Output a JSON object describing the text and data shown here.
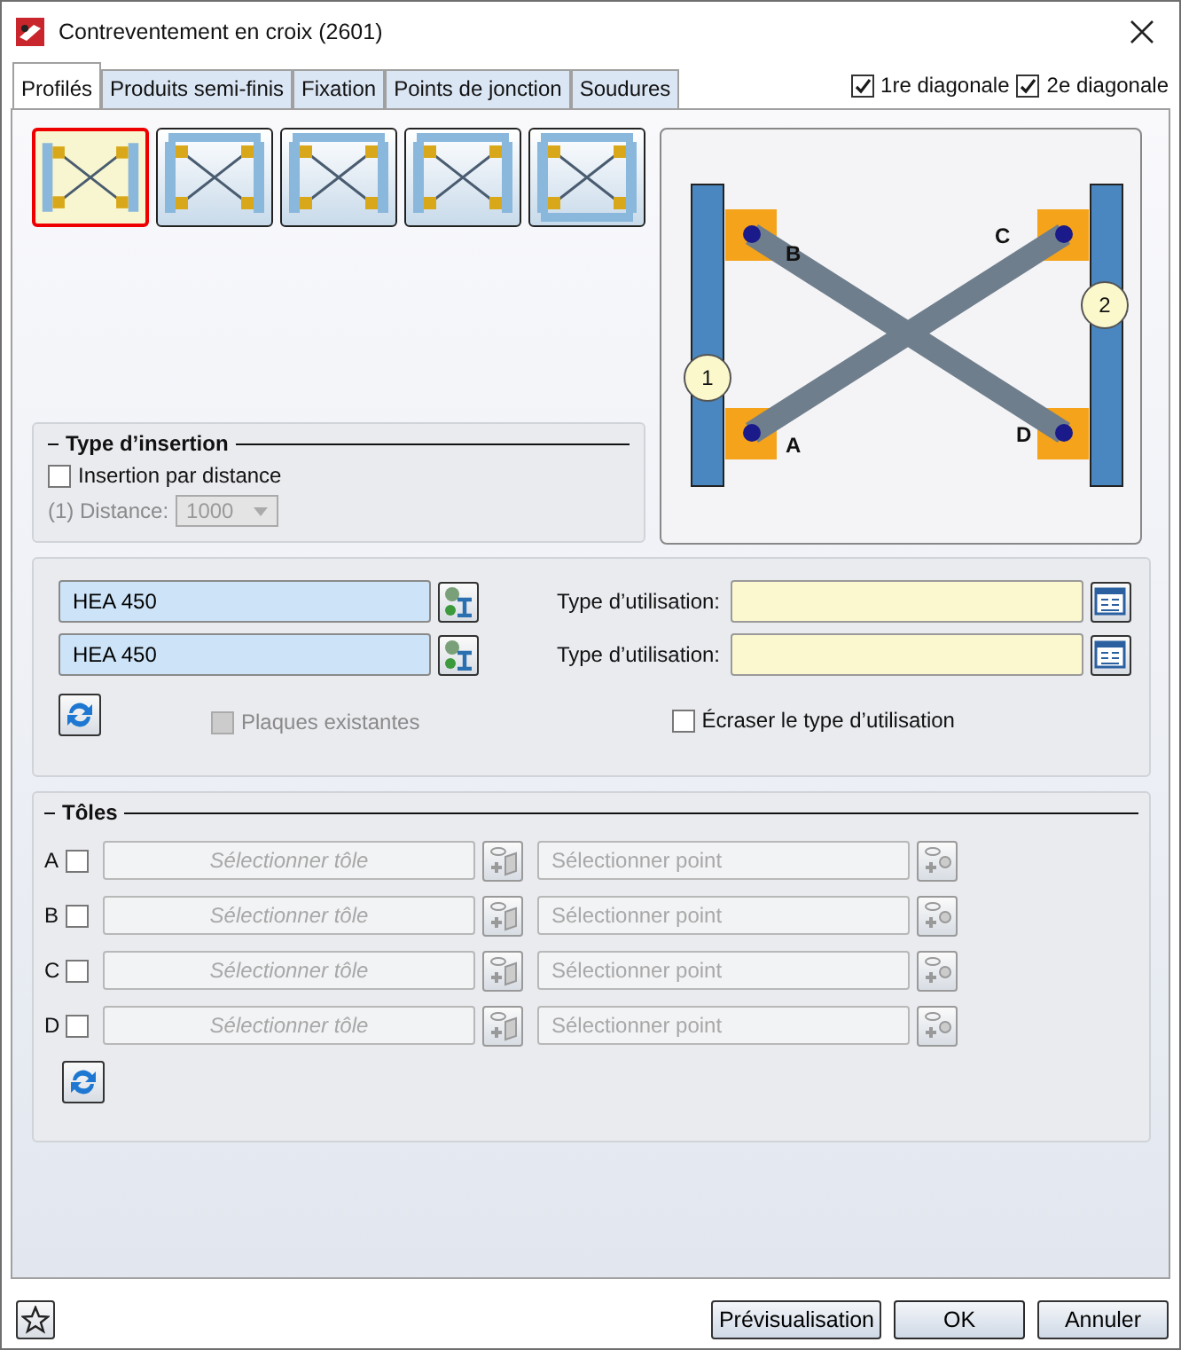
{
  "window": {
    "title": "Contreventement en croix (2601)"
  },
  "tabs": [
    {
      "label": "Profilés",
      "selected": true
    },
    {
      "label": "Produits semi-finis",
      "selected": false
    },
    {
      "label": "Fixation",
      "selected": false
    },
    {
      "label": "Points de jonction",
      "selected": false
    },
    {
      "label": "Soudures",
      "selected": false
    }
  ],
  "diagonals": [
    {
      "label": "1re diagonale",
      "checked": true
    },
    {
      "label": "2e diagonale",
      "checked": true
    }
  ],
  "variants": [
    {
      "kind": "columns",
      "selected": true
    },
    {
      "kind": "top-beam",
      "selected": false
    },
    {
      "kind": "top-beam",
      "selected": false
    },
    {
      "kind": "top-beam",
      "selected": false
    },
    {
      "kind": "frame",
      "selected": false
    }
  ],
  "diagram": {
    "points": [
      "B",
      "C",
      "D",
      "A"
    ],
    "members": [
      "1",
      "2"
    ]
  },
  "insertion": {
    "title": "Type d’insertion",
    "by_distance": {
      "label": "Insertion par distance",
      "checked": false
    },
    "distance_label": "(1) Distance:",
    "distance_value": "1000",
    "disabled": true
  },
  "profiles": [
    {
      "value": "HEA 450",
      "usage_label": "Type d’utilisation:"
    },
    {
      "value": "HEA 450",
      "usage_label": "Type d’utilisation:"
    }
  ],
  "existing_plates": {
    "label": "Plaques existantes",
    "checked": false,
    "disabled": true
  },
  "override_usage": {
    "label": "Écraser le type d’utilisation",
    "checked": false
  },
  "plates": {
    "title": "Tôles",
    "rows": [
      {
        "letter": "A",
        "checked": false,
        "plate_placeholder": "Sélectionner tôle",
        "point_placeholder": "Sélectionner point"
      },
      {
        "letter": "B",
        "checked": false,
        "plate_placeholder": "Sélectionner tôle",
        "point_placeholder": "Sélectionner point"
      },
      {
        "letter": "C",
        "checked": false,
        "plate_placeholder": "Sélectionner tôle",
        "point_placeholder": "Sélectionner point"
      },
      {
        "letter": "D",
        "checked": false,
        "plate_placeholder": "Sélectionner tôle",
        "point_placeholder": "Sélectionner point"
      }
    ]
  },
  "buttons": [
    "Prévisualisation",
    "OK",
    "Annuler"
  ]
}
